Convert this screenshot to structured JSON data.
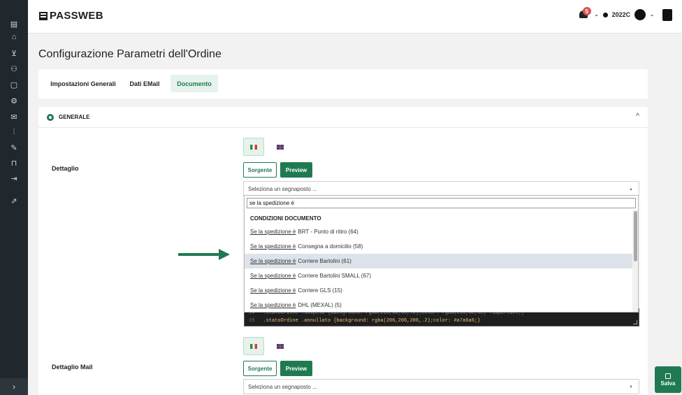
{
  "app": {
    "logo_text": "PASSWEB"
  },
  "topbar": {
    "notification_count": "5",
    "user_label": "2022C"
  },
  "sidebar": {
    "icons": [
      "menu-icon",
      "home-icon",
      "cart-icon",
      "users-icon",
      "document-icon",
      "settings-icon",
      "mail-icon",
      "chart-icon",
      "pencil-icon",
      "lock-icon",
      "logout-icon",
      "external-link-icon"
    ],
    "collapse_glyph": "›"
  },
  "page": {
    "title": "Configurazione Parametri dell'Ordine"
  },
  "tabs": [
    {
      "label": "Impostazioni Generali",
      "active": false
    },
    {
      "label": "Dati EMail",
      "active": false
    },
    {
      "label": "Documento",
      "active": true
    }
  ],
  "section": {
    "title": "GENERALE",
    "chevron": "^"
  },
  "dettaglio": {
    "label": "Dettaglio",
    "source_label": "Sorgente",
    "preview_label": "Preview",
    "placeholder_select": "Seleziona un segnaposto ...",
    "search_value": "se la spedizione è",
    "group_title": "CONDIZIONI DOCUMENTO",
    "options": [
      {
        "prefix": "Se la spedizione è",
        "text": "BRT - Punto di ritiro (64)",
        "highlighted": false
      },
      {
        "prefix": "Se la spedizione è",
        "text": "Consegna a domicilio (58)",
        "highlighted": false
      },
      {
        "prefix": "Se la spedizione è",
        "text": "Corriere Bartolini (61)",
        "highlighted": true
      },
      {
        "prefix": "Se la spedizione è",
        "text": "Corriere Bartolini SMALL (67)",
        "highlighted": false
      },
      {
        "prefix": "Se la spedizione è",
        "text": "Corriere GLS (15)",
        "highlighted": false
      },
      {
        "prefix": "Se la spedizione è",
        "text": "DHL (MEXAL) (5)",
        "highlighted": false
      }
    ],
    "code_lines": [
      {
        "n": "14",
        "code": ".statoOrdine .sospeso {background: rgba(218,68,33,.2);color: rgba(218,68,33) !important;}"
      },
      {
        "n": "15",
        "code": ".statoOrdine .annullato {background: rgba(206,206,206,.2);color: #a7a6a6;}"
      }
    ]
  },
  "dettaglio_mail": {
    "label": "Dettaglio Mail",
    "source_label": "Sorgente",
    "preview_label": "Preview",
    "placeholder_select": "Seleziona un segnaposto ..."
  },
  "save": {
    "label": "Salva"
  },
  "colors": {
    "accent": "#1f7a52",
    "sidebar": "#20282e",
    "highlight": "#dde3ea"
  }
}
